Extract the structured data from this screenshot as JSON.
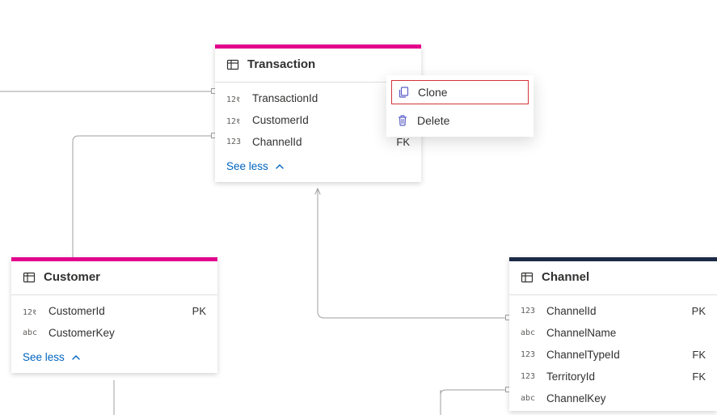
{
  "colors": {
    "accent_pink": "#e3008c",
    "accent_navy": "#1b2a47",
    "link_blue": "#0064bf",
    "menu_icon": "#5b5fc7",
    "highlight_border": "#d13438"
  },
  "context_menu": {
    "items": [
      {
        "label": "Clone",
        "icon": "copy-icon",
        "highlighted": true
      },
      {
        "label": "Delete",
        "icon": "trash-icon",
        "highlighted": false
      }
    ]
  },
  "entities": {
    "transaction": {
      "title": "Transaction",
      "accent": "#e3008c",
      "columns": [
        {
          "type": "12१",
          "name": "TransactionId",
          "key": ""
        },
        {
          "type": "12१",
          "name": "CustomerId",
          "key": ""
        },
        {
          "type": "123",
          "name": "ChannelId",
          "key": "FK"
        }
      ],
      "toggle_label": "See less"
    },
    "customer": {
      "title": "Customer",
      "accent": "#e3008c",
      "columns": [
        {
          "type": "12१",
          "name": "CustomerId",
          "key": "PK"
        },
        {
          "type": "abc",
          "name": "CustomerKey",
          "key": ""
        }
      ],
      "toggle_label": "See less"
    },
    "channel": {
      "title": "Channel",
      "accent": "#1b2a47",
      "columns": [
        {
          "type": "123",
          "name": "ChannelId",
          "key": "PK"
        },
        {
          "type": "abc",
          "name": "ChannelName",
          "key": ""
        },
        {
          "type": "123",
          "name": "ChannelTypeId",
          "key": "FK"
        },
        {
          "type": "123",
          "name": "TerritoryId",
          "key": "FK"
        },
        {
          "type": "abc",
          "name": "ChannelKey",
          "key": ""
        }
      ],
      "toggle_label": "See less"
    }
  }
}
